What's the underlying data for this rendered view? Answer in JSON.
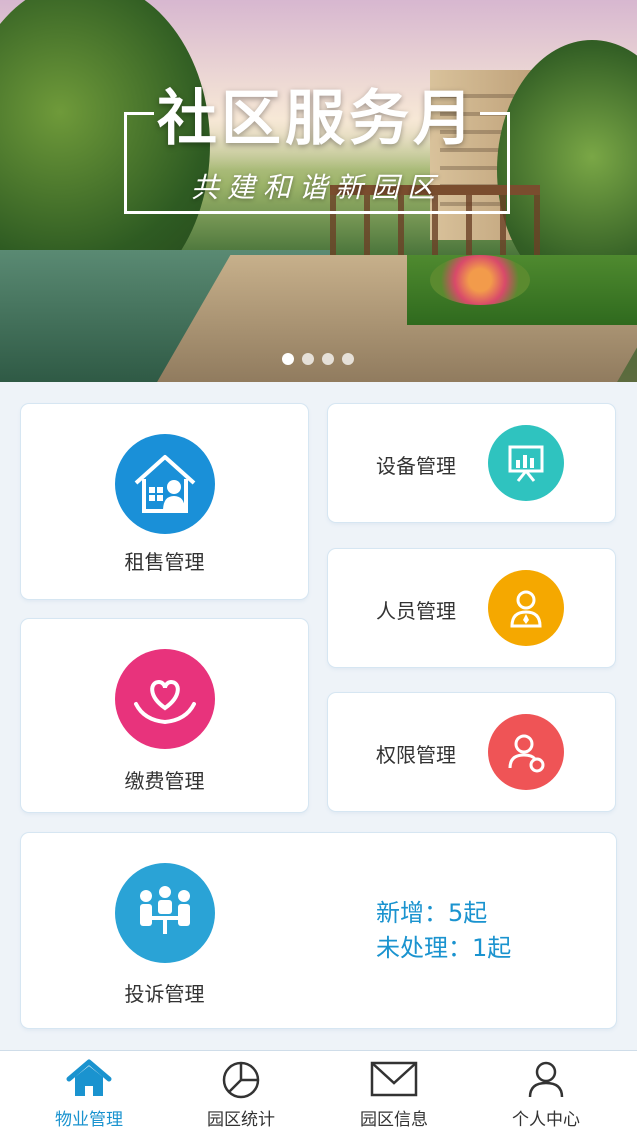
{
  "banner": {
    "title": "社区服务月",
    "subtitle": "共建和谐新园区",
    "pages": 4,
    "active_page": 1
  },
  "menu": {
    "rental": {
      "label": "租售管理",
      "color": "#1a90d8",
      "icon": "house-person-icon"
    },
    "equipment": {
      "label": "设备管理",
      "color": "#2fc3bf",
      "icon": "presentation-board-icon"
    },
    "staff": {
      "label": "人员管理",
      "color": "#f5a800",
      "icon": "staff-person-icon"
    },
    "payment": {
      "label": "缴费管理",
      "color": "#e8337c",
      "icon": "heart-hands-icon"
    },
    "permission": {
      "label": "权限管理",
      "color": "#ef5456",
      "icon": "user-permission-icon"
    },
    "complaint": {
      "label": "投诉管理",
      "color": "#2aa3d6",
      "icon": "meeting-people-icon",
      "new_line": "新增：5起",
      "pending_line": "未处理：1起"
    }
  },
  "tabbar": {
    "active_color": "#1a93cf",
    "items": [
      {
        "label": "物业管理",
        "icon": "home-icon",
        "active": true
      },
      {
        "label": "园区统计",
        "icon": "pie-chart-icon",
        "active": false
      },
      {
        "label": "园区信息",
        "icon": "mail-icon",
        "active": false
      },
      {
        "label": "个人中心",
        "icon": "user-icon",
        "active": false
      }
    ]
  }
}
